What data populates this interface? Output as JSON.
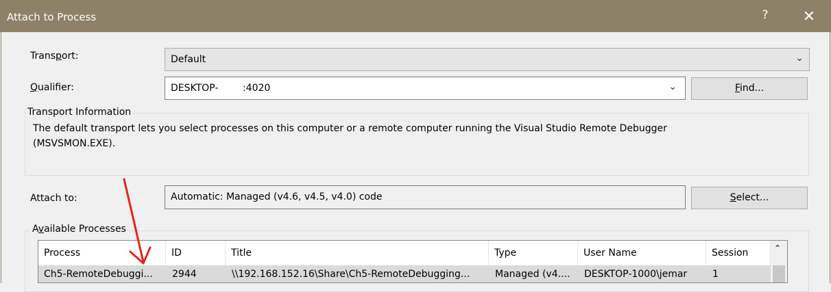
{
  "window": {
    "title": "Attach to Process",
    "help_glyph": "?",
    "close_glyph": "✕"
  },
  "transport": {
    "label_pre": "Trans",
    "label_u": "p",
    "label_post": "ort:",
    "value": "Default"
  },
  "qualifier": {
    "label_u": "Q",
    "label_post": "ualifier:",
    "value": "DESKTOP-        :4020"
  },
  "find_button": {
    "label_u": "F",
    "label_post": "ind..."
  },
  "transport_info": {
    "legend": "Transport Information",
    "line1": "The default transport lets you select processes on this computer or a remote computer running the Visual Studio Remote Debugger",
    "line2": "(MSVSMON.EXE)."
  },
  "attach_to": {
    "label": "Attach to:",
    "value": "Automatic: Managed (v4.6, v4.5, v4.0) code"
  },
  "select_button": {
    "label_u": "S",
    "label_post": "elect..."
  },
  "available_processes": {
    "legend_pre": "A",
    "legend_u": "v",
    "legend_post": "ailable Processes",
    "columns": [
      "Process",
      "ID",
      "Title",
      "Type",
      "User Name",
      "Session"
    ],
    "rows": [
      {
        "process": "Ch5-RemoteDebuggi...",
        "id": "2944",
        "title": "\\\\192.168.152.16\\Share\\Ch5-RemoteDebugging...",
        "type": "Managed (v4....",
        "user": "DESKTOP-1000\\jemar",
        "session": "1"
      }
    ]
  },
  "colors": {
    "titlebar": "#8d8167",
    "annotation_arrow": "#e8231a",
    "selected_row": "#dadada"
  }
}
